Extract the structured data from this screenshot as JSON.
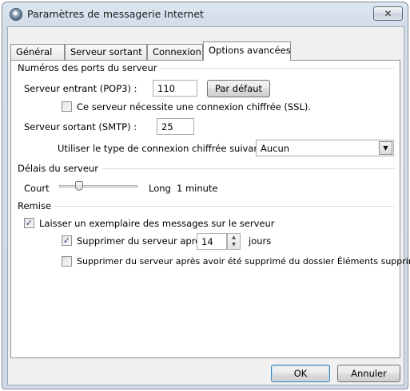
{
  "window": {
    "title": "Paramètres de messagerie Internet",
    "close_label": "✕"
  },
  "tabs": [
    {
      "label": "Général"
    },
    {
      "label": "Serveur sortant"
    },
    {
      "label": "Connexion"
    },
    {
      "label": "Options avancées",
      "active": true
    }
  ],
  "ports": {
    "group_label": "Numéros des ports du serveur",
    "incoming_label": "Serveur entrant (POP3) :",
    "incoming_value": "110",
    "default_button": "Par défaut",
    "ssl_label": "Ce serveur nécessite une connexion chiffrée (SSL).",
    "ssl_checked": false,
    "outgoing_label": "Serveur sortant (SMTP) :",
    "outgoing_value": "25",
    "encryption_label": "Utiliser le type de connexion chiffrée suivant :",
    "encryption_value": "Aucun"
  },
  "timeout": {
    "group_label": "Délais du serveur",
    "short_label": "Court",
    "long_label": "Long",
    "value_text": "1 minute",
    "slider_level": 0.25
  },
  "delivery": {
    "group_label": "Remise",
    "leave_copy_label": "Laisser un exemplaire des messages sur le serveur",
    "leave_copy_checked": true,
    "remove_after_label": "Supprimer du serveur après",
    "remove_after_checked": true,
    "remove_after_days": "14",
    "days_label": "jours",
    "remove_deleted_label": "Supprimer du serveur après avoir été supprimé du dossier Éléments supprimés",
    "remove_deleted_checked": false
  },
  "footer": {
    "ok_label": "OK",
    "cancel_label": "Annuler"
  },
  "icons": {
    "check_glyph": "✓",
    "dropdown_glyph": "▼",
    "spin_up": "▲",
    "spin_down": "▼"
  }
}
